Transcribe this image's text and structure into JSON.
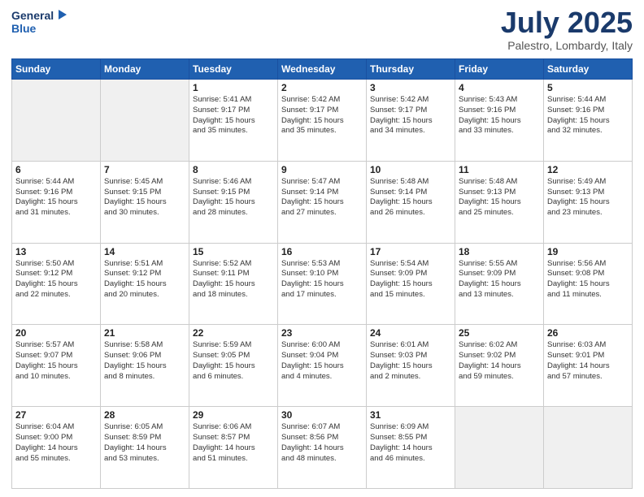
{
  "header": {
    "logo_line1": "General",
    "logo_line2": "Blue",
    "month_title": "July 2025",
    "subtitle": "Palestro, Lombardy, Italy"
  },
  "weekdays": [
    "Sunday",
    "Monday",
    "Tuesday",
    "Wednesday",
    "Thursday",
    "Friday",
    "Saturday"
  ],
  "weeks": [
    [
      {
        "day": "",
        "detail": ""
      },
      {
        "day": "",
        "detail": ""
      },
      {
        "day": "1",
        "detail": "Sunrise: 5:41 AM\nSunset: 9:17 PM\nDaylight: 15 hours\nand 35 minutes."
      },
      {
        "day": "2",
        "detail": "Sunrise: 5:42 AM\nSunset: 9:17 PM\nDaylight: 15 hours\nand 35 minutes."
      },
      {
        "day": "3",
        "detail": "Sunrise: 5:42 AM\nSunset: 9:17 PM\nDaylight: 15 hours\nand 34 minutes."
      },
      {
        "day": "4",
        "detail": "Sunrise: 5:43 AM\nSunset: 9:16 PM\nDaylight: 15 hours\nand 33 minutes."
      },
      {
        "day": "5",
        "detail": "Sunrise: 5:44 AM\nSunset: 9:16 PM\nDaylight: 15 hours\nand 32 minutes."
      }
    ],
    [
      {
        "day": "6",
        "detail": "Sunrise: 5:44 AM\nSunset: 9:16 PM\nDaylight: 15 hours\nand 31 minutes."
      },
      {
        "day": "7",
        "detail": "Sunrise: 5:45 AM\nSunset: 9:15 PM\nDaylight: 15 hours\nand 30 minutes."
      },
      {
        "day": "8",
        "detail": "Sunrise: 5:46 AM\nSunset: 9:15 PM\nDaylight: 15 hours\nand 28 minutes."
      },
      {
        "day": "9",
        "detail": "Sunrise: 5:47 AM\nSunset: 9:14 PM\nDaylight: 15 hours\nand 27 minutes."
      },
      {
        "day": "10",
        "detail": "Sunrise: 5:48 AM\nSunset: 9:14 PM\nDaylight: 15 hours\nand 26 minutes."
      },
      {
        "day": "11",
        "detail": "Sunrise: 5:48 AM\nSunset: 9:13 PM\nDaylight: 15 hours\nand 25 minutes."
      },
      {
        "day": "12",
        "detail": "Sunrise: 5:49 AM\nSunset: 9:13 PM\nDaylight: 15 hours\nand 23 minutes."
      }
    ],
    [
      {
        "day": "13",
        "detail": "Sunrise: 5:50 AM\nSunset: 9:12 PM\nDaylight: 15 hours\nand 22 minutes."
      },
      {
        "day": "14",
        "detail": "Sunrise: 5:51 AM\nSunset: 9:12 PM\nDaylight: 15 hours\nand 20 minutes."
      },
      {
        "day": "15",
        "detail": "Sunrise: 5:52 AM\nSunset: 9:11 PM\nDaylight: 15 hours\nand 18 minutes."
      },
      {
        "day": "16",
        "detail": "Sunrise: 5:53 AM\nSunset: 9:10 PM\nDaylight: 15 hours\nand 17 minutes."
      },
      {
        "day": "17",
        "detail": "Sunrise: 5:54 AM\nSunset: 9:09 PM\nDaylight: 15 hours\nand 15 minutes."
      },
      {
        "day": "18",
        "detail": "Sunrise: 5:55 AM\nSunset: 9:09 PM\nDaylight: 15 hours\nand 13 minutes."
      },
      {
        "day": "19",
        "detail": "Sunrise: 5:56 AM\nSunset: 9:08 PM\nDaylight: 15 hours\nand 11 minutes."
      }
    ],
    [
      {
        "day": "20",
        "detail": "Sunrise: 5:57 AM\nSunset: 9:07 PM\nDaylight: 15 hours\nand 10 minutes."
      },
      {
        "day": "21",
        "detail": "Sunrise: 5:58 AM\nSunset: 9:06 PM\nDaylight: 15 hours\nand 8 minutes."
      },
      {
        "day": "22",
        "detail": "Sunrise: 5:59 AM\nSunset: 9:05 PM\nDaylight: 15 hours\nand 6 minutes."
      },
      {
        "day": "23",
        "detail": "Sunrise: 6:00 AM\nSunset: 9:04 PM\nDaylight: 15 hours\nand 4 minutes."
      },
      {
        "day": "24",
        "detail": "Sunrise: 6:01 AM\nSunset: 9:03 PM\nDaylight: 15 hours\nand 2 minutes."
      },
      {
        "day": "25",
        "detail": "Sunrise: 6:02 AM\nSunset: 9:02 PM\nDaylight: 14 hours\nand 59 minutes."
      },
      {
        "day": "26",
        "detail": "Sunrise: 6:03 AM\nSunset: 9:01 PM\nDaylight: 14 hours\nand 57 minutes."
      }
    ],
    [
      {
        "day": "27",
        "detail": "Sunrise: 6:04 AM\nSunset: 9:00 PM\nDaylight: 14 hours\nand 55 minutes."
      },
      {
        "day": "28",
        "detail": "Sunrise: 6:05 AM\nSunset: 8:59 PM\nDaylight: 14 hours\nand 53 minutes."
      },
      {
        "day": "29",
        "detail": "Sunrise: 6:06 AM\nSunset: 8:57 PM\nDaylight: 14 hours\nand 51 minutes."
      },
      {
        "day": "30",
        "detail": "Sunrise: 6:07 AM\nSunset: 8:56 PM\nDaylight: 14 hours\nand 48 minutes."
      },
      {
        "day": "31",
        "detail": "Sunrise: 6:09 AM\nSunset: 8:55 PM\nDaylight: 14 hours\nand 46 minutes."
      },
      {
        "day": "",
        "detail": ""
      },
      {
        "day": "",
        "detail": ""
      }
    ]
  ]
}
